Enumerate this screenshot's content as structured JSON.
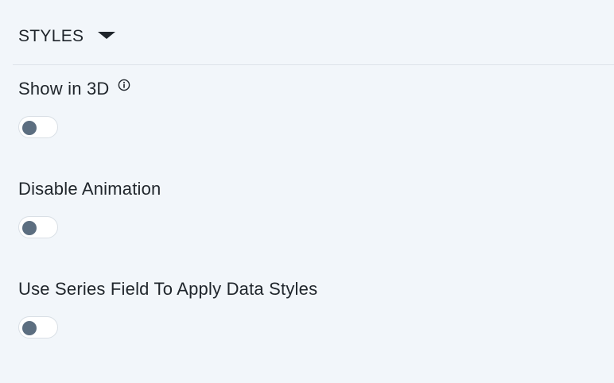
{
  "section": {
    "title": "STYLES"
  },
  "settings": [
    {
      "label": "Show in 3D",
      "has_info": true,
      "enabled": false
    },
    {
      "label": "Disable Animation",
      "has_info": false,
      "enabled": false
    },
    {
      "label": "Use Series Field To Apply Data Styles",
      "has_info": false,
      "enabled": false
    }
  ],
  "icons": {
    "section_toggle": "caret-down-icon",
    "info": "info-icon"
  },
  "colors": {
    "background": "#f2f6fa",
    "text": "#1f252b",
    "toggle_knob": "#5c6e80",
    "toggle_track": "#ffffff",
    "divider": "#dde3e9"
  }
}
